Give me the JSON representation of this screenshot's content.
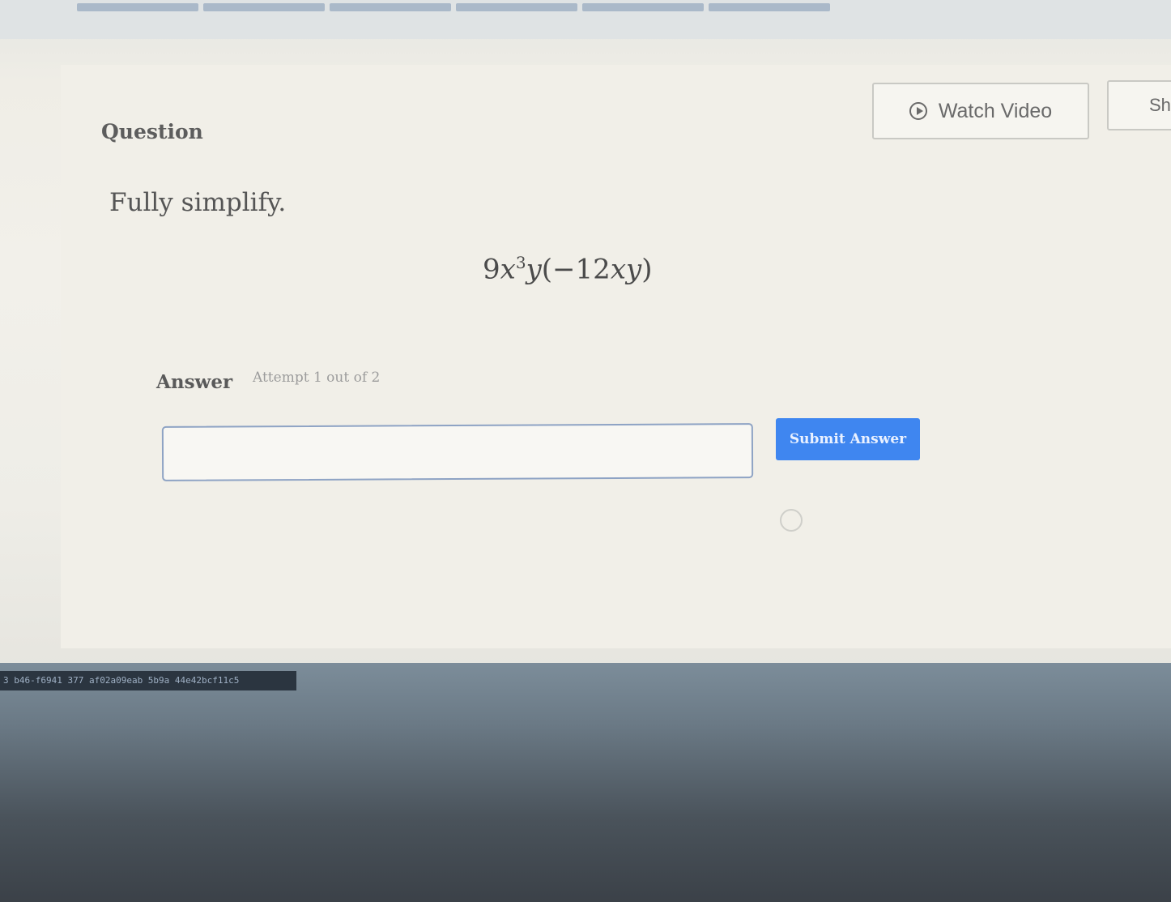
{
  "header": {
    "watch_video_label": "Watch Video",
    "show_button_label": "Sh"
  },
  "question": {
    "heading": "Question",
    "instruction": "Fully simplify.",
    "expression": {
      "coefficient": "9",
      "var1": "x",
      "exponent": "3",
      "var2": "y",
      "paren_open": "(",
      "inner_coefficient": "−12",
      "inner_var1": "x",
      "inner_var2": "y",
      "paren_close": ")"
    }
  },
  "answer": {
    "label": "Answer",
    "attempt_text": "Attempt 1 out of 2",
    "input_value": "",
    "submit_label": "Submit Answer"
  },
  "footer": {
    "session_id": "3 b46-f6941 377 af02a09eab 5b9a 44e42bcf11c5"
  }
}
